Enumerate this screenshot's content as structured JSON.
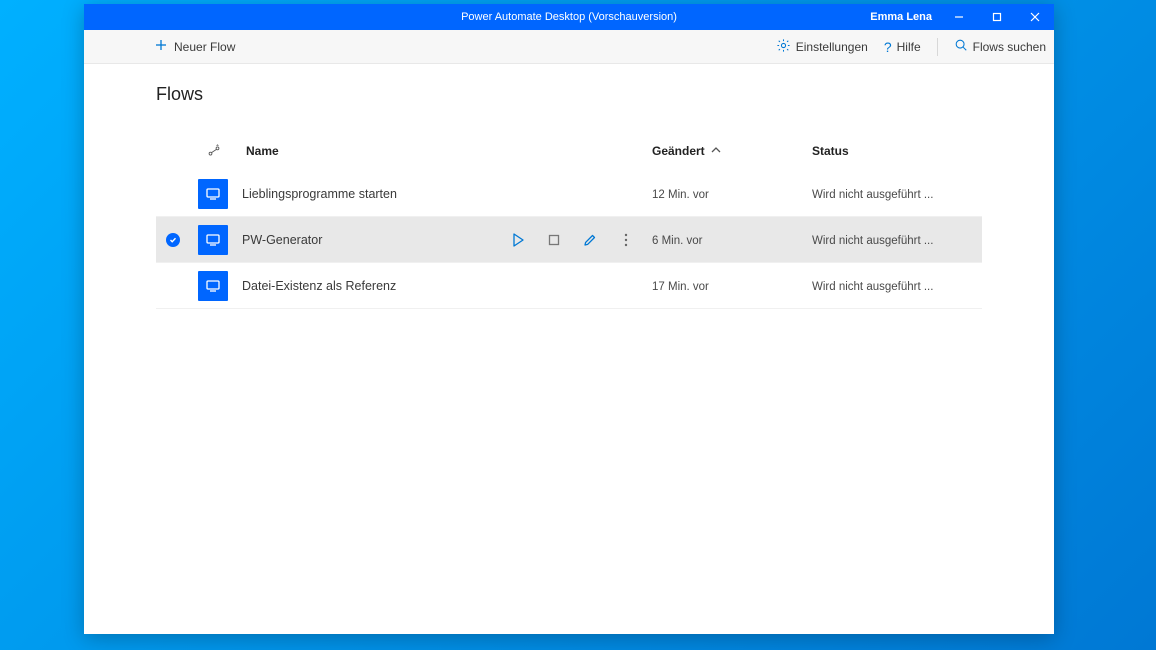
{
  "titlebar": {
    "title": "Power Automate Desktop (Vorschauversion)",
    "user": "Emma Lena"
  },
  "toolbar": {
    "new_flow": "Neuer Flow",
    "settings": "Einstellungen",
    "help": "Hilfe",
    "search": "Flows suchen"
  },
  "page": {
    "title": "Flows"
  },
  "columns": {
    "name": "Name",
    "modified": "Geändert",
    "status": "Status"
  },
  "flows": [
    {
      "name": "Lieblingsprogramme starten",
      "modified": "12 Min. vor",
      "status": "Wird nicht ausgeführt ...",
      "selected": false
    },
    {
      "name": "PW-Generator",
      "modified": "6 Min. vor",
      "status": "Wird nicht ausgeführt ...",
      "selected": true
    },
    {
      "name": "Datei-Existenz als Referenz",
      "modified": "17 Min. vor",
      "status": "Wird nicht ausgeführt ...",
      "selected": false
    }
  ]
}
